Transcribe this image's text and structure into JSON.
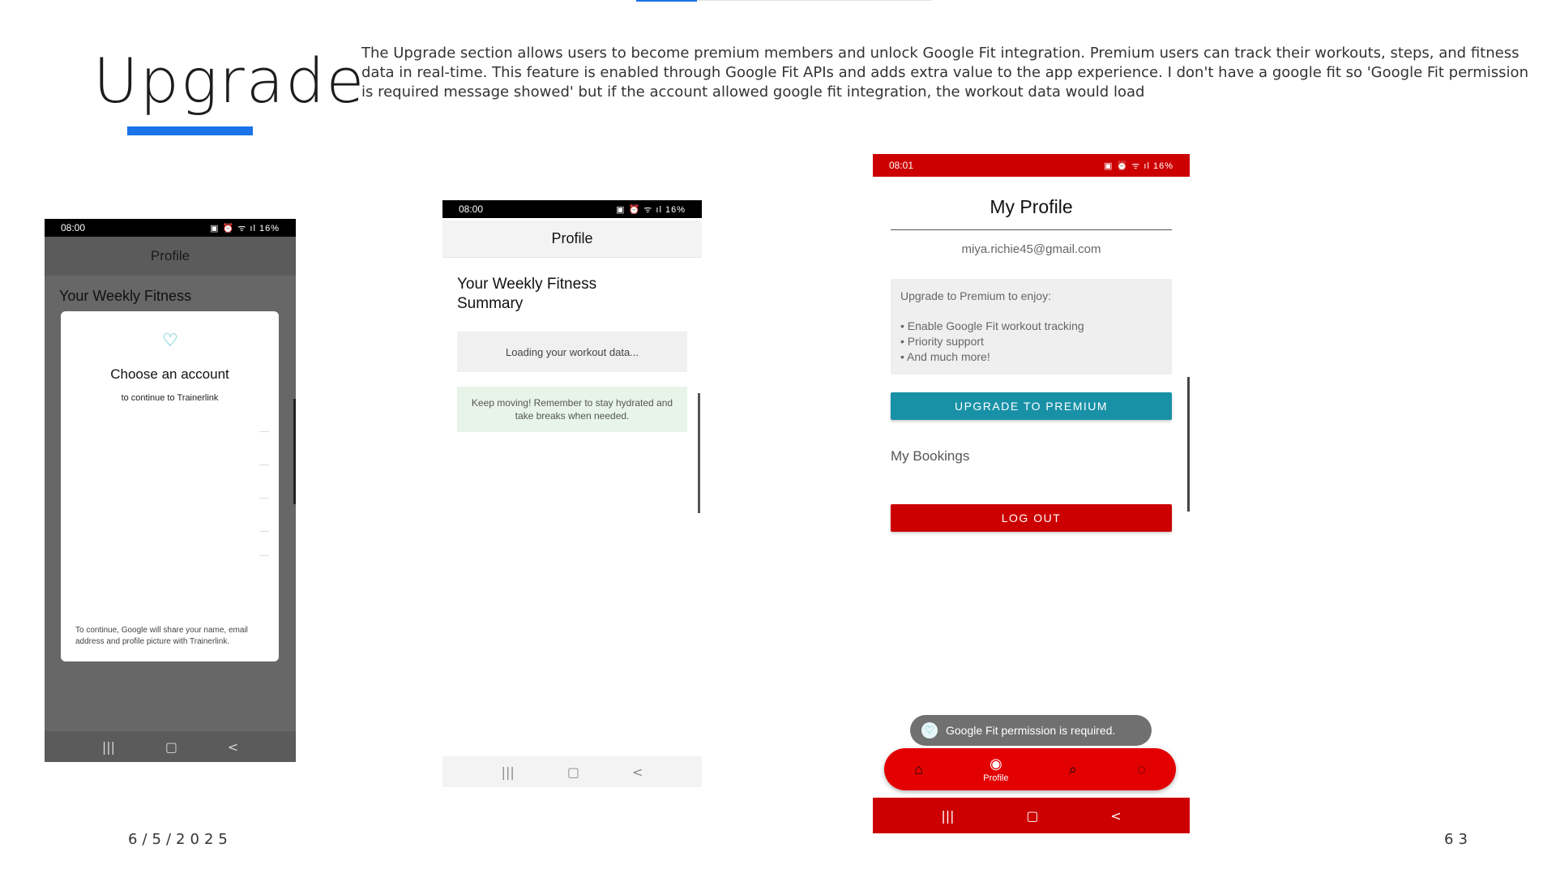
{
  "slide": {
    "title": "Upgrade",
    "description": "The Upgrade section allows users to become premium members and unlock Google Fit integration. Premium users can track their workouts, steps, and fitness data in real-time. This feature is enabled through Google Fit APIs and adds extra value to the app experience. I don't have a google fit so 'Google Fit permission is required message showed' but if the account allowed google fit integration, the workout data would load",
    "date": "6/5/2025",
    "page_number": "63",
    "accent_color": "#1a73e8"
  },
  "phone1": {
    "status_time": "08:00",
    "status_battery": "16%",
    "header": "Profile",
    "weekly_heading": "Your Weekly Fitness",
    "dialog": {
      "logo_icon": "heart-logo-icon",
      "title": "Choose an account",
      "subtitle": "to continue to Trainerlink",
      "footer": "To continue, Google will share your name, email address and profile picture with Trainerlink."
    },
    "nav": [
      "|||",
      "▢",
      "<"
    ]
  },
  "phone2": {
    "status_time": "08:00",
    "status_battery": "16%",
    "header": "Profile",
    "summary_heading": "Your Weekly Fitness Summary",
    "loading_text": "Loading your workout data...",
    "tip_text": "Keep moving! Remember to stay hydrated and take breaks when needed.",
    "nav": [
      "|||",
      "▢",
      "<"
    ]
  },
  "phone3": {
    "status_time": "08:01",
    "status_battery": "16%",
    "title": "My Profile",
    "email": "miya.richie45@gmail.com",
    "premium_intro": "Upgrade to Premium to enjoy:",
    "premium_features": [
      "• Enable Google Fit workout tracking",
      "• Priority support",
      "• And much more!"
    ],
    "upgrade_button": "UPGRADE TO PREMIUM",
    "bookings_label": "My Bookings",
    "logout_button": "LOG OUT",
    "toast": "Google Fit permission is required.",
    "bottom_nav": {
      "home_icon": "home-icon",
      "profile_label": "Profile",
      "search_icon": "search-icon",
      "chat_icon": "chat-icon"
    },
    "nav": [
      "|||",
      "▢",
      "<"
    ],
    "brand_color": "#cc0000",
    "premium_button_color": "#1891a7"
  }
}
